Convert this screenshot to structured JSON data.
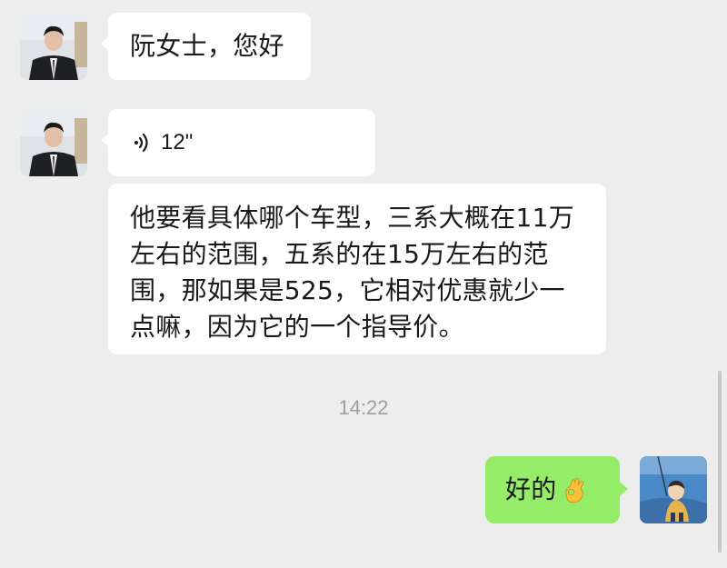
{
  "messages": {
    "greeting": "阮女士，您好",
    "voice_duration": "12\"",
    "transcript": "他要看具体哪个车型，三系大概在11万左右的范围，五系的在15万左右的范围，那如果是525，它相对优惠就少一点嘛，因为它的一个指导价。",
    "timestamp": "14:22",
    "reply": "好的"
  },
  "icons": {
    "voice": "voice-wave-icon",
    "reply_emoji": "ok-hand-emoji-icon"
  },
  "colors": {
    "background": "#ededed",
    "incoming_bubble": "#ffffff",
    "outgoing_bubble": "#95ec69",
    "timestamp_text": "#9e9e9e"
  }
}
